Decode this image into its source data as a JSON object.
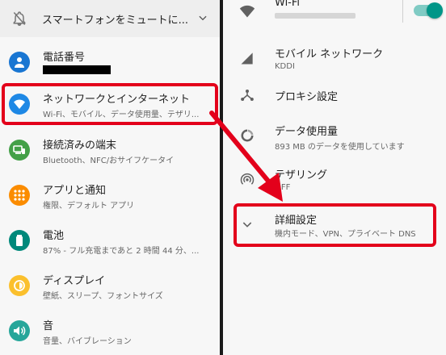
{
  "left": {
    "notification": {
      "text": "スマートフォンをミュートに...",
      "icon": "bell-off-icon"
    },
    "items": [
      {
        "title": "電話番号",
        "subtitle": "",
        "icon": "person-icon",
        "color": "#1976d2"
      },
      {
        "title": "ネットワークとインターネット",
        "subtitle": "Wi-Fi、モバイル、データ使用量、テザリ...",
        "icon": "wifi-icon",
        "color": "#1e88e5"
      },
      {
        "title": "接続済みの端末",
        "subtitle": "Bluetooth、NFC/おサイフケータイ",
        "icon": "devices-icon",
        "color": "#43a047"
      },
      {
        "title": "アプリと通知",
        "subtitle": "権限、デフォルト アプリ",
        "icon": "apps-icon",
        "color": "#fb8c00"
      },
      {
        "title": "電池",
        "subtitle": "87% - フル充電まであと 2 時間 44 分、...",
        "icon": "battery-icon",
        "color": "#00897b"
      },
      {
        "title": "ディスプレイ",
        "subtitle": "壁紙、スリープ、フォントサイズ",
        "icon": "brightness-icon",
        "color": "#fbc02d"
      },
      {
        "title": "音",
        "subtitle": "音量、バイブレーション",
        "icon": "volume-icon",
        "color": "#26a69a"
      }
    ]
  },
  "right": {
    "wifi": {
      "title": "Wi-Fi",
      "icon": "wifi-signal-icon",
      "toggle_on": true
    },
    "items": [
      {
        "title": "モバイル ネットワーク",
        "subtitle": "KDDI",
        "icon": "signal-icon"
      },
      {
        "title": "プロキシ設定",
        "subtitle": "",
        "icon": "proxy-icon"
      },
      {
        "title": "データ使用量",
        "subtitle": "893 MB のデータを使用しています",
        "icon": "data-usage-icon"
      },
      {
        "title": "テザリング",
        "subtitle": "OFF",
        "icon": "hotspot-icon"
      },
      {
        "title": "詳細設定",
        "subtitle": "機内モード、VPN、プライベート DNS",
        "icon": "chevron-down-icon"
      }
    ]
  },
  "colors": {
    "highlight": "#e3001b",
    "accent": "#009688"
  }
}
